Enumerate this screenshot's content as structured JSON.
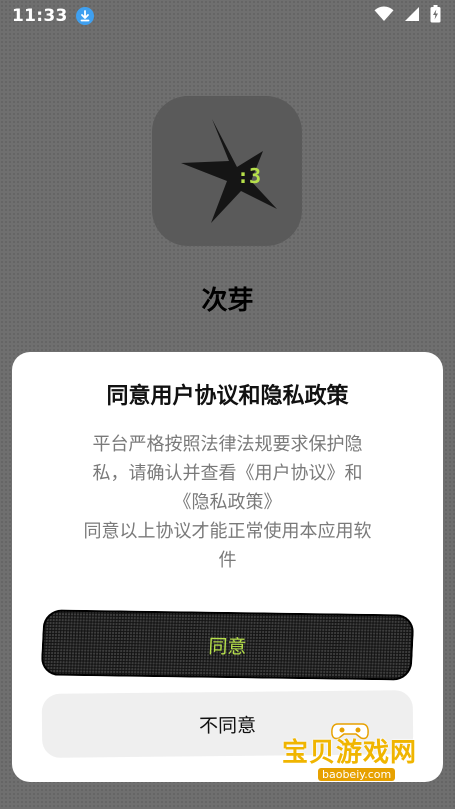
{
  "status_bar": {
    "time": "11:33"
  },
  "app": {
    "name": "次芽",
    "icon_text": ":3"
  },
  "dialog": {
    "title": "同意用户协议和隐私政策",
    "body_line1": "平台严格按照法律法规要求保护隐",
    "body_line2": "私，请确认并查看《用户协议》和",
    "body_line3": "《隐私政策》",
    "body_line4": "同意以上协议才能正常使用本应用软",
    "body_line5": "件",
    "agree_label": "同意",
    "disagree_label": "不同意"
  },
  "watermark": {
    "text": "宝贝游戏网",
    "url": "baobeiy.com"
  },
  "colors": {
    "accent_text": "#b6e04a",
    "download_badge": "#3fa0f0",
    "watermark": "#f0b500"
  }
}
